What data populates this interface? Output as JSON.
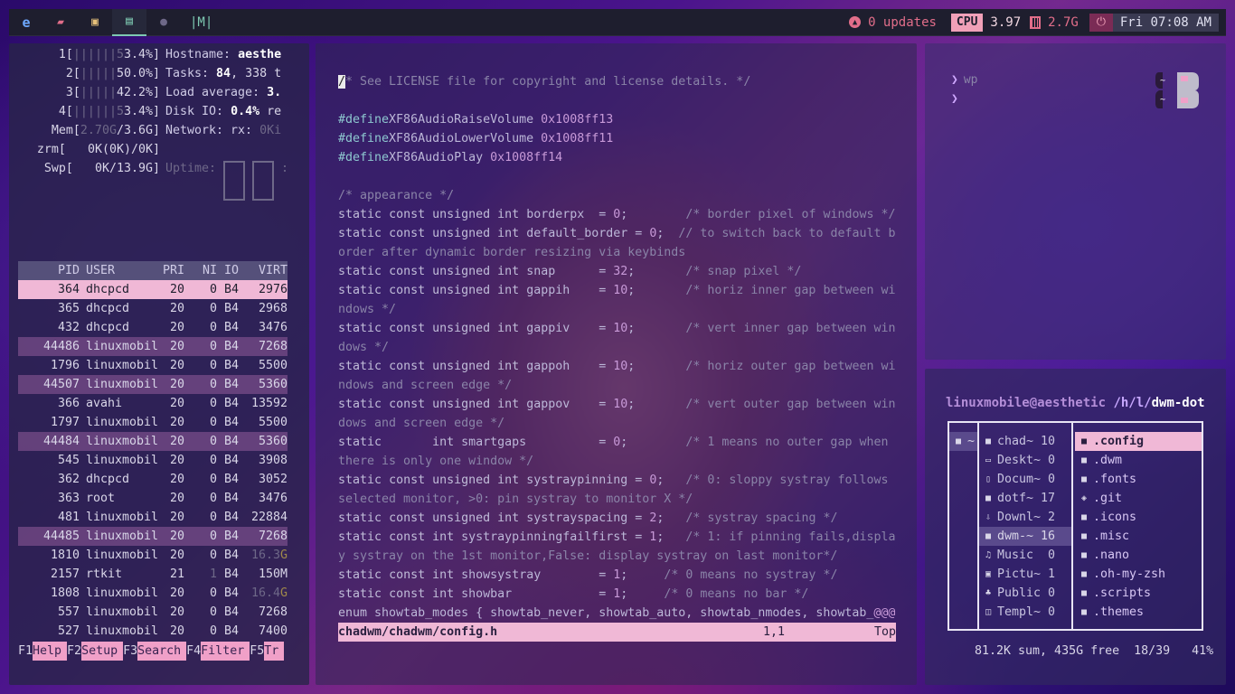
{
  "bar": {
    "tags": [
      {
        "name": "e",
        "color": "#6ea8ff"
      },
      {
        "name": "folder",
        "color": "#e26e8a"
      },
      {
        "name": "term",
        "color": "#e6c07b"
      },
      {
        "name": "doc",
        "color": "#7ec9b2"
      },
      {
        "name": "circle",
        "color": "#6e6888"
      }
    ],
    "layout": "|M|",
    "updates": "0 updates",
    "cpu_label": "CPU",
    "cpu_value": "3.97",
    "mem_value": "2.7G",
    "clock": "Fri 07:08 AM"
  },
  "htop": {
    "cpu_rows": [
      {
        "id": "1",
        "bars": "||||||5",
        "pct": "3.4%]"
      },
      {
        "id": "2",
        "bars": "|||||",
        "pct": "50.0%]"
      },
      {
        "id": "3",
        "bars": "|||||",
        "pct": "42.2%]"
      },
      {
        "id": "4",
        "bars": "||||||5",
        "pct": "3.4%]"
      }
    ],
    "hostname_label": "Hostname:",
    "hostname": "aesthe",
    "tasks_label": "Tasks:",
    "tasks_count": "84",
    "tasks_rest": ", 338 t",
    "load_label": "Load average:",
    "load_value": "3.",
    "disk_label": "Disk IO:",
    "disk_value": "0.4%",
    "disk_rest": " re",
    "mem_label": "Mem[",
    "mem_value": "2.70G",
    "mem_total": "/3.6G]",
    "net_label": "Network: rx:",
    "net_value": "0Ki",
    "zrm_label": "zrm[",
    "zrm_value": "   0K(0K)/0K]",
    "swp_label": "Swp[",
    "swp_value": "   0K/13.9G]",
    "uptime_label": "Uptime:",
    "uptime_colon": ":",
    "headers": [
      "PID",
      "USER",
      "PRI",
      "NI",
      "IO",
      "VIRT"
    ],
    "processes": [
      {
        "pid": "364",
        "user": "dhcpcd",
        "pri": "20",
        "ni": "0",
        "io": "B4",
        "virt": "2976",
        "state": "sel"
      },
      {
        "pid": "365",
        "user": "dhcpcd",
        "pri": "20",
        "ni": "0",
        "io": "B4",
        "virt": "2968",
        "state": ""
      },
      {
        "pid": "432",
        "user": "dhcpcd",
        "pri": "20",
        "ni": "0",
        "io": "B4",
        "virt": "3476",
        "state": ""
      },
      {
        "pid": "44486",
        "user": "linuxmobil",
        "pri": "20",
        "ni": "0",
        "io": "B4",
        "virt": "7268",
        "state": "hl"
      },
      {
        "pid": "1796",
        "user": "linuxmobil",
        "pri": "20",
        "ni": "0",
        "io": "B4",
        "virt": "5500",
        "state": ""
      },
      {
        "pid": "44507",
        "user": "linuxmobil",
        "pri": "20",
        "ni": "0",
        "io": "B4",
        "virt": "5360",
        "state": "hl"
      },
      {
        "pid": "366",
        "user": "avahi",
        "pri": "20",
        "ni": "0",
        "io": "B4",
        "virt": "13592",
        "state": ""
      },
      {
        "pid": "1797",
        "user": "linuxmobil",
        "pri": "20",
        "ni": "0",
        "io": "B4",
        "virt": "5500",
        "state": ""
      },
      {
        "pid": "44484",
        "user": "linuxmobil",
        "pri": "20",
        "ni": "0",
        "io": "B4",
        "virt": "5360",
        "state": "hl"
      },
      {
        "pid": "545",
        "user": "linuxmobil",
        "pri": "20",
        "ni": "0",
        "io": "B4",
        "virt": "3908",
        "state": ""
      },
      {
        "pid": "362",
        "user": "dhcpcd",
        "pri": "20",
        "ni": "0",
        "io": "B4",
        "virt": "3052",
        "state": ""
      },
      {
        "pid": "363",
        "user": "root",
        "pri": "20",
        "ni": "0",
        "io": "B4",
        "virt": "3476",
        "state": ""
      },
      {
        "pid": "481",
        "user": "linuxmobil",
        "pri": "20",
        "ni": "0",
        "io": "B4",
        "virt": "22884",
        "state": ""
      },
      {
        "pid": "44485",
        "user": "linuxmobil",
        "pri": "20",
        "ni": "0",
        "io": "B4",
        "virt": "7268",
        "state": "hl"
      },
      {
        "pid": "1810",
        "user": "linuxmobil",
        "pri": "20",
        "ni": "0",
        "io": "B4",
        "virt": "16.3G",
        "state": ""
      },
      {
        "pid": "2157",
        "user": "rtkit",
        "pri": "21",
        "ni": "1",
        "io": "B4",
        "virt": "150M",
        "state": ""
      },
      {
        "pid": "1808",
        "user": "linuxmobil",
        "pri": "20",
        "ni": "0",
        "io": "B4",
        "virt": "16.4G",
        "state": ""
      },
      {
        "pid": "557",
        "user": "linuxmobil",
        "pri": "20",
        "ni": "0",
        "io": "B4",
        "virt": "7268",
        "state": ""
      },
      {
        "pid": "527",
        "user": "linuxmobil",
        "pri": "20",
        "ni": "0",
        "io": "B4",
        "virt": "7400",
        "state": ""
      }
    ],
    "fkeys": [
      {
        "k": "F1",
        "l": "Help  "
      },
      {
        "k": "F2",
        "l": "Setup "
      },
      {
        "k": "F3",
        "l": "Search"
      },
      {
        "k": "F4",
        "l": "Filter"
      },
      {
        "k": "F5",
        "l": "Tr"
      }
    ]
  },
  "editor": {
    "lines": [
      [
        [
          "cursor",
          "/"
        ],
        [
          "cm",
          "* See LICENSE file for copyright and license details. */"
        ]
      ],
      [],
      [
        [
          "kw",
          "#define"
        ],
        [
          "",
          "XF86AudioRaiseVolume "
        ],
        [
          "num",
          "0x1008ff13"
        ]
      ],
      [
        [
          "kw",
          "#define"
        ],
        [
          "",
          "XF86AudioLowerVolume "
        ],
        [
          "num",
          "0x1008ff11"
        ]
      ],
      [
        [
          "kw",
          "#define"
        ],
        [
          "",
          "XF86AudioPlay "
        ],
        [
          "num",
          "0x1008ff14"
        ]
      ],
      [],
      [
        [
          "cm",
          "/* appearance */"
        ]
      ],
      [
        [
          "",
          "static const unsigned int borderpx  = "
        ],
        [
          "num",
          "0"
        ],
        [
          "",
          ";        "
        ],
        [
          "cm",
          "/* border pixel of windows */"
        ]
      ],
      [
        [
          "",
          "static const unsigned int default_border = "
        ],
        [
          "num",
          "0"
        ],
        [
          "",
          ";  "
        ],
        [
          "cm",
          "// to switch back to default b"
        ]
      ],
      [
        [
          "cm",
          "order after dynamic border resizing via keybinds"
        ]
      ],
      [
        [
          "",
          "static const unsigned int snap      = "
        ],
        [
          "num",
          "32"
        ],
        [
          "",
          ";       "
        ],
        [
          "cm",
          "/* snap pixel */"
        ]
      ],
      [
        [
          "",
          "static const unsigned int gappih    = "
        ],
        [
          "num",
          "10"
        ],
        [
          "",
          ";       "
        ],
        [
          "cm",
          "/* horiz inner gap between wi"
        ]
      ],
      [
        [
          "cm",
          "ndows */"
        ]
      ],
      [
        [
          "",
          "static const unsigned int gappiv    = "
        ],
        [
          "num",
          "10"
        ],
        [
          "",
          ";       "
        ],
        [
          "cm",
          "/* vert inner gap between win"
        ]
      ],
      [
        [
          "cm",
          "dows */"
        ]
      ],
      [
        [
          "",
          "static const unsigned int gappoh    = "
        ],
        [
          "num",
          "10"
        ],
        [
          "",
          ";       "
        ],
        [
          "cm",
          "/* horiz outer gap between wi"
        ]
      ],
      [
        [
          "cm",
          "ndows and screen edge */"
        ]
      ],
      [
        [
          "",
          "static const unsigned int gappov    = "
        ],
        [
          "num",
          "10"
        ],
        [
          "",
          ";       "
        ],
        [
          "cm",
          "/* vert outer gap between win"
        ]
      ],
      [
        [
          "cm",
          "dows and screen edge */"
        ]
      ],
      [
        [
          "",
          "static       int smartgaps          = "
        ],
        [
          "num",
          "0"
        ],
        [
          "",
          ";        "
        ],
        [
          "cm",
          "/* 1 means no outer gap when "
        ]
      ],
      [
        [
          "cm",
          "there is only one window */"
        ]
      ],
      [
        [
          "",
          "static const unsigned int systraypinning = "
        ],
        [
          "num",
          "0"
        ],
        [
          "",
          ";   "
        ],
        [
          "cm",
          "/* 0: sloppy systray follows "
        ]
      ],
      [
        [
          "cm",
          "selected monitor, >0: pin systray to monitor X */"
        ]
      ],
      [
        [
          "",
          "static const unsigned int systrayspacing = "
        ],
        [
          "num",
          "2"
        ],
        [
          "",
          ";   "
        ],
        [
          "cm",
          "/* systray spacing */"
        ]
      ],
      [
        [
          "",
          "static const int systraypinningfailfirst = "
        ],
        [
          "num",
          "1"
        ],
        [
          "",
          ";   "
        ],
        [
          "cm",
          "/* 1: if pinning fails,displa"
        ]
      ],
      [
        [
          "cm",
          "y systray on the 1st monitor,False: display systray on last monitor*/"
        ]
      ],
      [
        [
          "",
          "static const int showsystray        = "
        ],
        [
          "num",
          "1"
        ],
        [
          "",
          ";     "
        ],
        [
          "cm",
          "/* 0 means no systray */"
        ]
      ],
      [
        [
          "",
          "static const int showbar            = "
        ],
        [
          "num",
          "1"
        ],
        [
          "",
          ";     "
        ],
        [
          "cm",
          "/* 0 means no bar */"
        ]
      ],
      [
        [
          "",
          "enum showtab_modes { showtab_never, showtab_auto, showtab_nmodes, showtab_"
        ],
        [
          "num",
          "@@@"
        ]
      ]
    ],
    "status_file": "chadwm/chadwm/config.h",
    "status_pos": "1,1",
    "status_scroll": "Top"
  },
  "term": {
    "prompt1": "wp",
    "tilde": "~"
  },
  "lf": {
    "user": "linuxmobile@aesthetic",
    "path_dim": " /h/l/",
    "path": "dwm-dot",
    "col1": [
      {
        "ic": "■",
        "name": "~"
      }
    ],
    "col2": [
      {
        "ic": "■",
        "name": "chad~ 10"
      },
      {
        "ic": "▭",
        "name": "Deskt~ 0"
      },
      {
        "ic": "▯",
        "name": "Docum~ 0"
      },
      {
        "ic": "■",
        "name": "dotf~ 17"
      },
      {
        "ic": "⇩",
        "name": "Downl~ 2"
      },
      {
        "ic": "■",
        "name": "dwm-~ 16"
      },
      {
        "ic": "♫",
        "name": "Music  0"
      },
      {
        "ic": "▣",
        "name": "Pictu~ 1"
      },
      {
        "ic": "♣",
        "name": "Public 0"
      },
      {
        "ic": "◫",
        "name": "Templ~ 0"
      }
    ],
    "col3": [
      {
        "ic": "■",
        "name": ".config"
      },
      {
        "ic": "■",
        "name": ".dwm"
      },
      {
        "ic": "■",
        "name": ".fonts"
      },
      {
        "ic": "◈",
        "name": ".git"
      },
      {
        "ic": "■",
        "name": ".icons"
      },
      {
        "ic": "■",
        "name": ".misc"
      },
      {
        "ic": "■",
        "name": ".nano"
      },
      {
        "ic": "■",
        "name": ".oh-my-zsh"
      },
      {
        "ic": "■",
        "name": ".scripts"
      },
      {
        "ic": "■",
        "name": ".themes"
      }
    ],
    "footer": "81.2K sum, 435G free  18/39   41%"
  }
}
